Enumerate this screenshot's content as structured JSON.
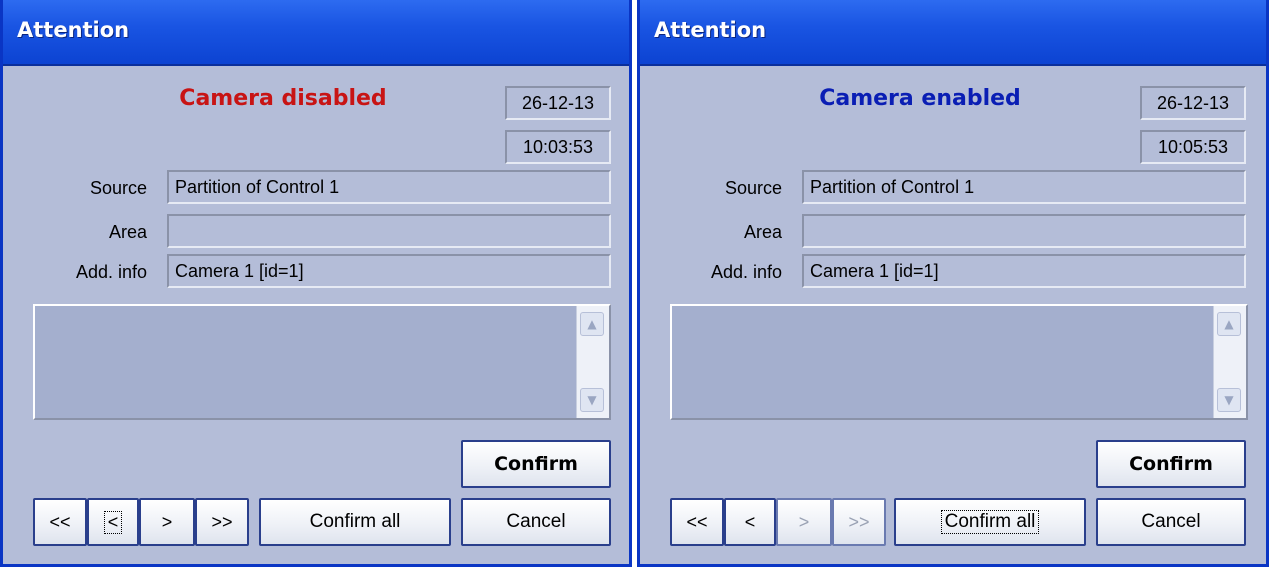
{
  "colors": {
    "title_bar": "#1a55e3",
    "dialog_bg": "#b4bdd8",
    "disabled_event": "#c81414",
    "enabled_event": "#0a1eb4"
  },
  "dialogs": [
    {
      "title": "Attention",
      "event": {
        "text": "Camera disabled",
        "color": "#c81414"
      },
      "date": "26-12-13",
      "time": "10:03:53",
      "fields": {
        "source_label": "Source",
        "source_value": "Partition of Control 1",
        "area_label": "Area",
        "area_value": "",
        "addinfo_label": "Add. info",
        "addinfo_value": "Camera 1 [id=1]"
      },
      "memo_text": "",
      "scroll_icons": {
        "up": "scroll-up-icon",
        "down": "scroll-down-icon"
      },
      "buttons": {
        "confirm": "Confirm",
        "first": "<<",
        "prev": "<",
        "next": ">",
        "last": ">>",
        "confirm_all": "Confirm all",
        "cancel": "Cancel"
      },
      "focused_button": "prev"
    },
    {
      "title": "Attention",
      "event": {
        "text": "Camera enabled",
        "color": "#0a1eb4"
      },
      "date": "26-12-13",
      "time": "10:05:53",
      "fields": {
        "source_label": "Source",
        "source_value": "Partition of Control 1",
        "area_label": "Area",
        "area_value": "",
        "addinfo_label": "Add. info",
        "addinfo_value": "Camera 1 [id=1]"
      },
      "memo_text": "",
      "scroll_icons": {
        "up": "scroll-up-icon",
        "down": "scroll-down-icon"
      },
      "buttons": {
        "confirm": "Confirm",
        "first": "<<",
        "prev": "<",
        "next": ">",
        "last": ">>",
        "confirm_all": "Confirm all",
        "cancel": "Cancel"
      },
      "focused_button": "confirm_all",
      "disabled_buttons": [
        "next",
        "last"
      ]
    }
  ]
}
